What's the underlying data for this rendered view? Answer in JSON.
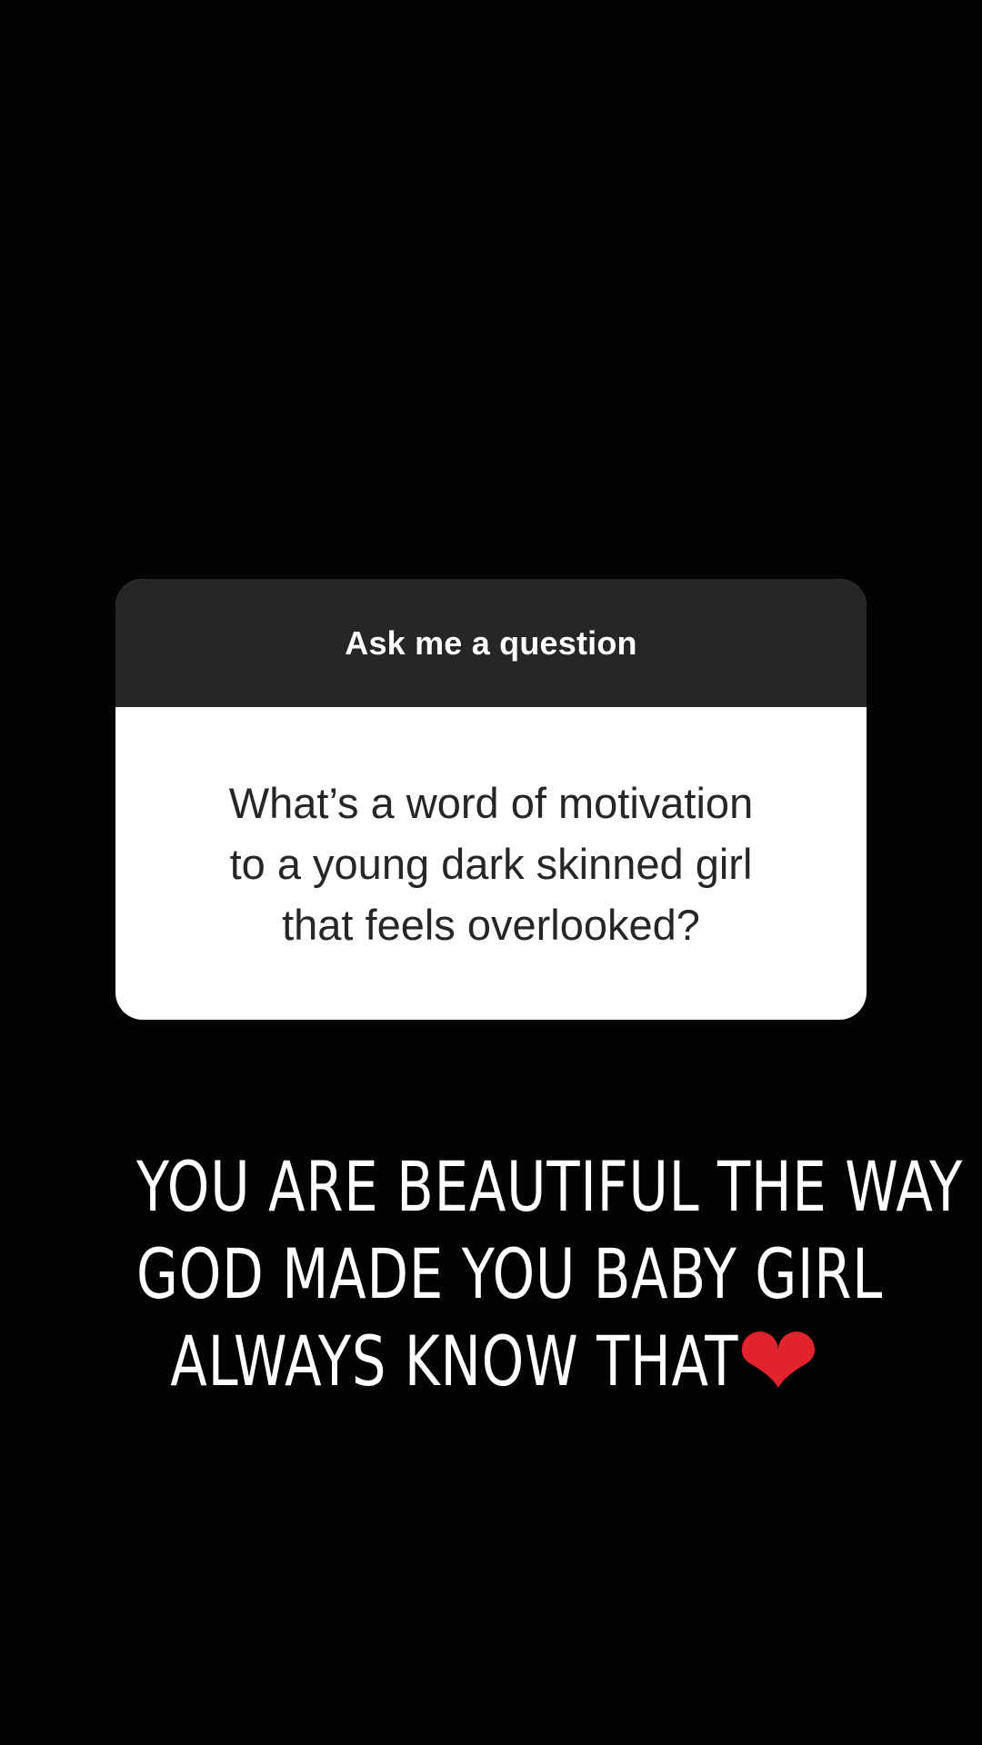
{
  "question_sticker": {
    "header": "Ask me a question",
    "question": "What’s a word of motivation\nto a young dark skinned girl\nthat feels overlooked?"
  },
  "answer": {
    "line1": "YOU ARE BEAUTIFUL THE WAY",
    "line2": "GOD MADE YOU BABY GIRL",
    "line3": "ALWAYS KNOW THAT",
    "emoji": "heart-icon"
  },
  "colors": {
    "background": "#030303",
    "sticker_header": "#262626",
    "sticker_body": "#ffffff",
    "heart": "#e0232c"
  }
}
